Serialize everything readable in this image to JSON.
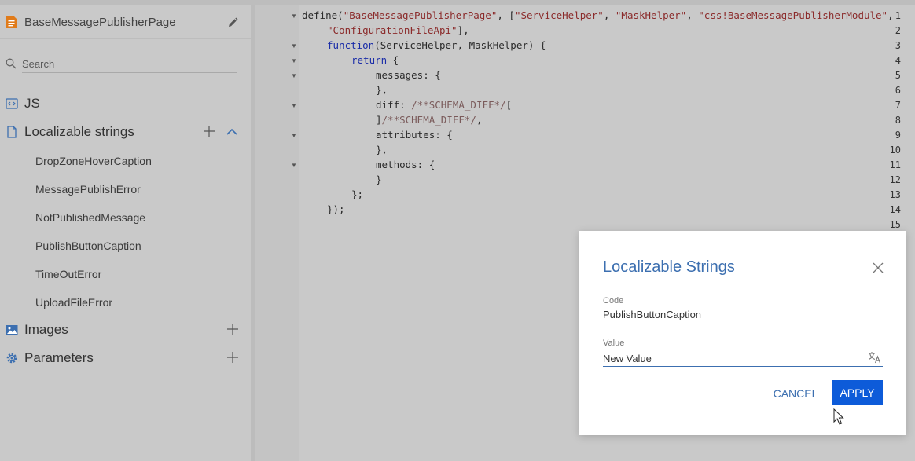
{
  "sidebar": {
    "title": "BaseMessagePublisherPage",
    "search_placeholder": "Search",
    "js_label": "JS",
    "localizable_label": "Localizable strings",
    "localizable_items": [
      "DropZoneHoverCaption",
      "MessagePublishError",
      "NotPublishedMessage",
      "PublishButtonCaption",
      "TimeOutError",
      "UploadFileError"
    ],
    "images_label": "Images",
    "parameters_label": "Parameters"
  },
  "editor": {
    "line_numbers": [
      "1",
      "2",
      "3",
      "4",
      "5",
      "6",
      "7",
      "8",
      "9",
      "10",
      "11",
      "12",
      "13",
      "14",
      "15"
    ],
    "line1": {
      "a": "define(",
      "b": "\"BaseMessagePublisherPage\"",
      "c": ", [",
      "d": "\"ServiceHelper\"",
      "e": ", ",
      "f": "\"MaskHelper\"",
      "g": ", ",
      "h": "\"css!BaseMessagePublisherModule\"",
      "i": ","
    },
    "line2": {
      "a": "\"ConfigurationFileApi\"",
      "b": "],"
    },
    "line3": {
      "a": "function",
      "b": "(ServiceHelper, MaskHelper) {"
    },
    "line4": {
      "a": "return",
      "b": " {"
    },
    "line5": "messages: {",
    "line6": "},",
    "line7": {
      "a": "diff: ",
      "b": "/**SCHEMA_DIFF*/",
      "c": "["
    },
    "line8": {
      "a": "]",
      "b": "/**SCHEMA_DIFF*/",
      "c": ","
    },
    "line9": "attributes: {",
    "line10": "},",
    "line11": "methods: {",
    "line12": "}",
    "line13": "};",
    "line14": "});"
  },
  "modal": {
    "title": "Localizable Strings",
    "code_label": "Code",
    "code_value": "PublishButtonCaption",
    "value_label": "Value",
    "value_value": "New Value",
    "cancel_label": "CANCEL",
    "apply_label": "APPLY"
  },
  "colors": {
    "accent": "#3c6fb0",
    "apply_button": "#0d5bd9",
    "icon_orange": "#e07b1a",
    "icon_blue": "#3c6fb0"
  }
}
